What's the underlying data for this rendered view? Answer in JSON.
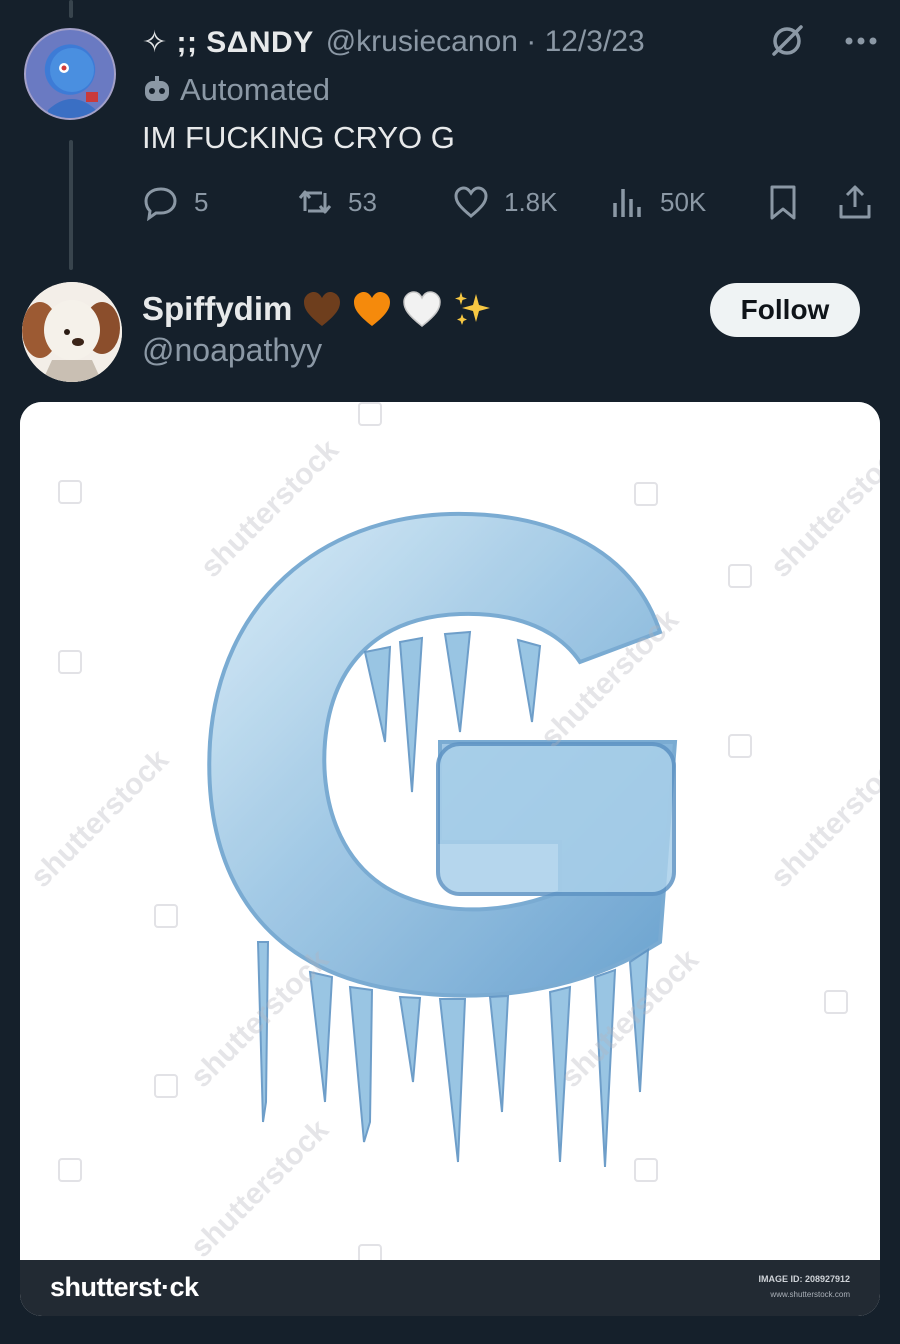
{
  "tweet1": {
    "display_name": "✧ ;; SΔNDY",
    "handle": "@krusiecanon",
    "date": "12/3/23",
    "automated_label": "Automated",
    "text": "IM FUCKING CRYO G",
    "replies": "5",
    "retweets": "53",
    "likes": "1.8K",
    "views": "50K",
    "icons": [
      "grok-icon",
      "more-icon",
      "robot-icon",
      "reply-icon",
      "retweet-icon",
      "like-icon",
      "views-icon",
      "bookmark-icon",
      "share-icon"
    ]
  },
  "tweet2": {
    "display_name": "Spiffydim",
    "emojis": [
      "🤎",
      "🧡",
      "🤍",
      "✨"
    ],
    "handle": "@noapathyy",
    "follow_label": "Follow"
  },
  "media": {
    "watermark": "shutterstock",
    "footer_logo": "shutterst·ck",
    "image_id": "IMAGE ID: 208927912",
    "url": "www.shutterstock.com"
  },
  "colors": {
    "background": "#15202b",
    "text_primary": "#e7e9ea",
    "text_secondary": "#8b98a5",
    "follow_bg": "#eff3f4"
  }
}
